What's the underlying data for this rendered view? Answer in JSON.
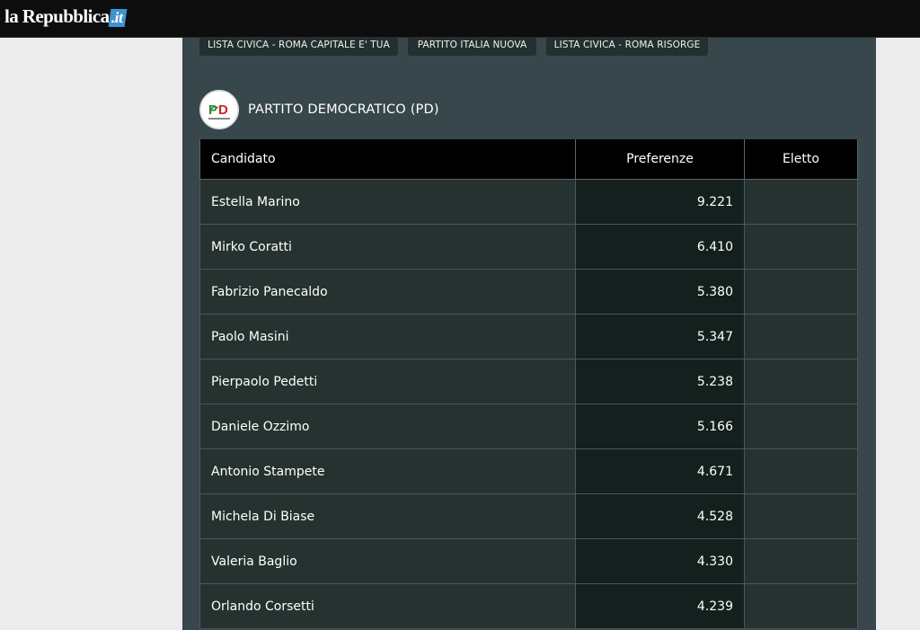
{
  "header": {
    "logo_main": "la Repubblica",
    "logo_tld": ".it"
  },
  "tabs": [
    {
      "label": "LISTA CIVICA - ROMA CAPITALE E' TUA"
    },
    {
      "label": "PARTITO ITALIA NUOVA"
    },
    {
      "label": "LISTA CIVICA - ROMA RISORGE"
    }
  ],
  "party": {
    "name": "PARTITO DEMOCRATICO (PD)",
    "logo_text": "PD",
    "logo_icon": "pd-party-logo"
  },
  "table": {
    "headers": {
      "candidate": "Candidato",
      "preferences": "Preferenze",
      "elected": "Eletto"
    },
    "rows": [
      {
        "name": "Estella Marino",
        "votes": "9.221",
        "elected": ""
      },
      {
        "name": "Mirko Coratti",
        "votes": "6.410",
        "elected": ""
      },
      {
        "name": "Fabrizio Panecaldo",
        "votes": "5.380",
        "elected": ""
      },
      {
        "name": "Paolo Masini",
        "votes": "5.347",
        "elected": ""
      },
      {
        "name": "Pierpaolo Pedetti",
        "votes": "5.238",
        "elected": ""
      },
      {
        "name": "Daniele Ozzimo",
        "votes": "5.166",
        "elected": ""
      },
      {
        "name": "Antonio Stampete",
        "votes": "4.671",
        "elected": ""
      },
      {
        "name": "Michela Di Biase",
        "votes": "4.528",
        "elected": ""
      },
      {
        "name": "Valeria Baglio",
        "votes": "4.330",
        "elected": ""
      },
      {
        "name": "Orlando Corsetti",
        "votes": "4.239",
        "elected": ""
      }
    ]
  },
  "colors": {
    "panel_bg": "#37474b",
    "header_bg": "#000000",
    "tab_bg": "#23302f",
    "logo_accent": "#3d93cf",
    "pd_green": "#2f8a3a",
    "pd_red": "#d3202a"
  }
}
